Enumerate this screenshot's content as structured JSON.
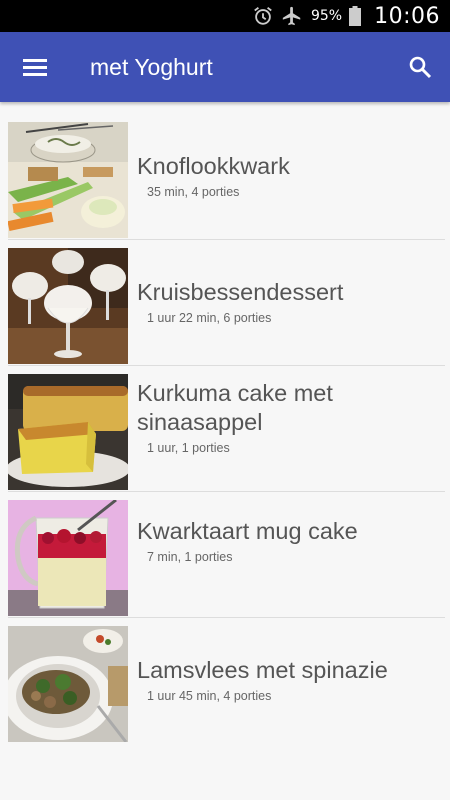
{
  "status": {
    "battery": "95%",
    "time": "10:06"
  },
  "toolbar": {
    "title": "met Yoghurt"
  },
  "recipes": [
    {
      "name": "Knoflookkwark",
      "meta": "35 min, 4 porties"
    },
    {
      "name": "Kruisbessendessert",
      "meta": "1 uur 22 min, 6 porties"
    },
    {
      "name": "Kurkuma cake met sinaasappel",
      "meta": "1 uur, 1 porties"
    },
    {
      "name": "Kwarktaart mug cake",
      "meta": "7 min, 1 porties"
    },
    {
      "name": "Lamsvlees met spinazie",
      "meta": "1 uur 45 min, 4 porties"
    }
  ],
  "colors": {
    "app_bar": "#3f51b5",
    "status_bar": "#000000",
    "background": "#f7f7f7"
  }
}
